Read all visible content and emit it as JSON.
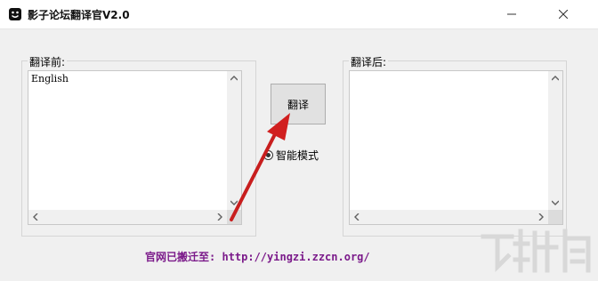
{
  "window": {
    "title": "影子论坛翻译官V2.0"
  },
  "left_panel": {
    "label": "翻译前:",
    "text": "English"
  },
  "right_panel": {
    "label": "翻译后:",
    "text": ""
  },
  "translate_button": {
    "label": "翻译"
  },
  "smart_mode": {
    "label": "智能模式",
    "checked": true
  },
  "footer": {
    "text": "官网已搬迁至: http://yingzi.zzcn.org/"
  },
  "colors": {
    "footer_text": "#7b1a8a",
    "arrow": "#d11f1f"
  }
}
